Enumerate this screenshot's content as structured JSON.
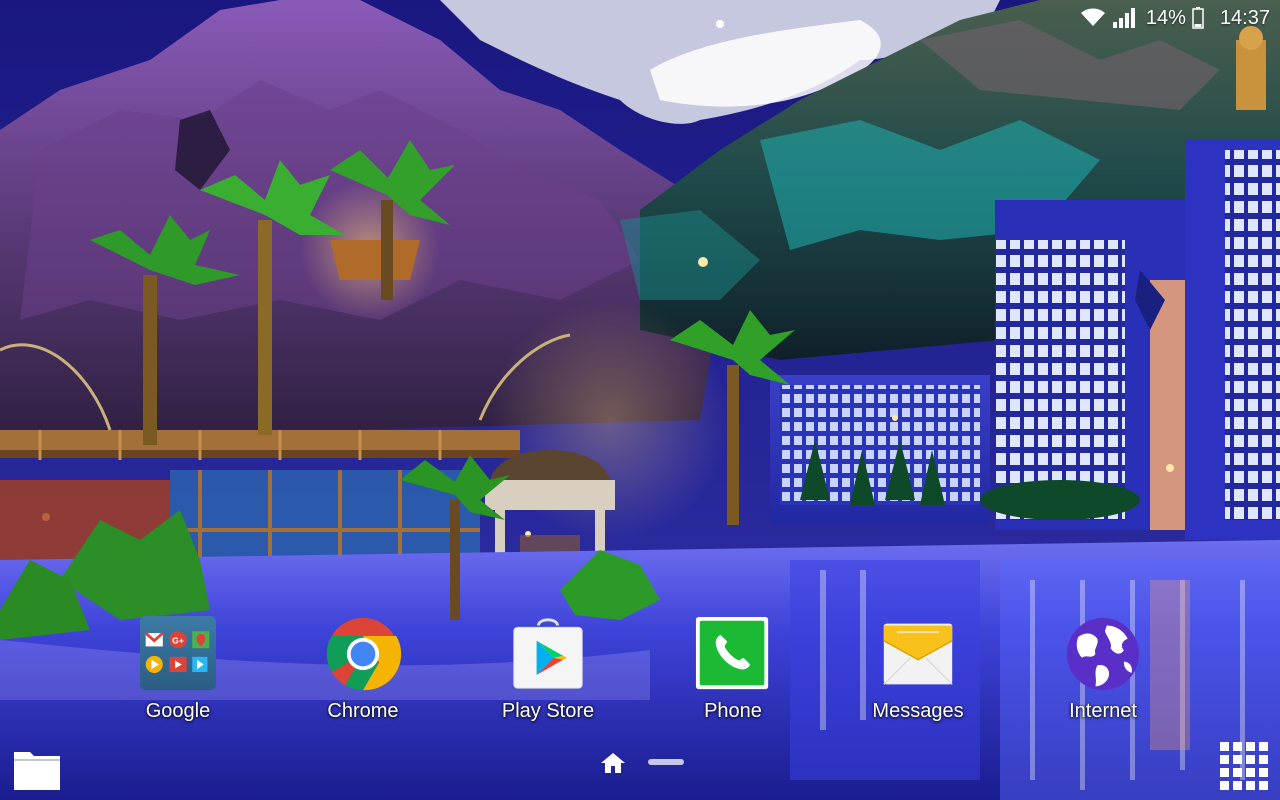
{
  "status_bar": {
    "battery": "14%",
    "time": "14:37",
    "icons": [
      "wifi-icon",
      "signal-icon",
      "battery-icon"
    ]
  },
  "apps": [
    {
      "id": "google",
      "label": "Google",
      "icon": "google-folder-icon"
    },
    {
      "id": "chrome",
      "label": "Chrome",
      "icon": "chrome-icon"
    },
    {
      "id": "play_store",
      "label": "Play Store",
      "icon": "play-store-icon"
    },
    {
      "id": "phone",
      "label": "Phone",
      "icon": "phone-icon"
    },
    {
      "id": "messages",
      "label": "Messages",
      "icon": "messages-icon"
    },
    {
      "id": "internet",
      "label": "Internet",
      "icon": "internet-icon"
    }
  ],
  "navigation": {
    "icons": [
      "files-icon",
      "home-icon",
      "page-indicator",
      "apps-grid-icon"
    ]
  },
  "colors": {
    "sky": "#1a1780",
    "water": "#3e43d8",
    "chrome_red": "#db4437",
    "chrome_green": "#0f9d58",
    "chrome_yellow": "#f4b400",
    "chrome_blue": "#4285f4",
    "phone_green": "#1bb934",
    "messages_yellow": "#f9c21a",
    "internet_purple": "#5a2fc8"
  }
}
